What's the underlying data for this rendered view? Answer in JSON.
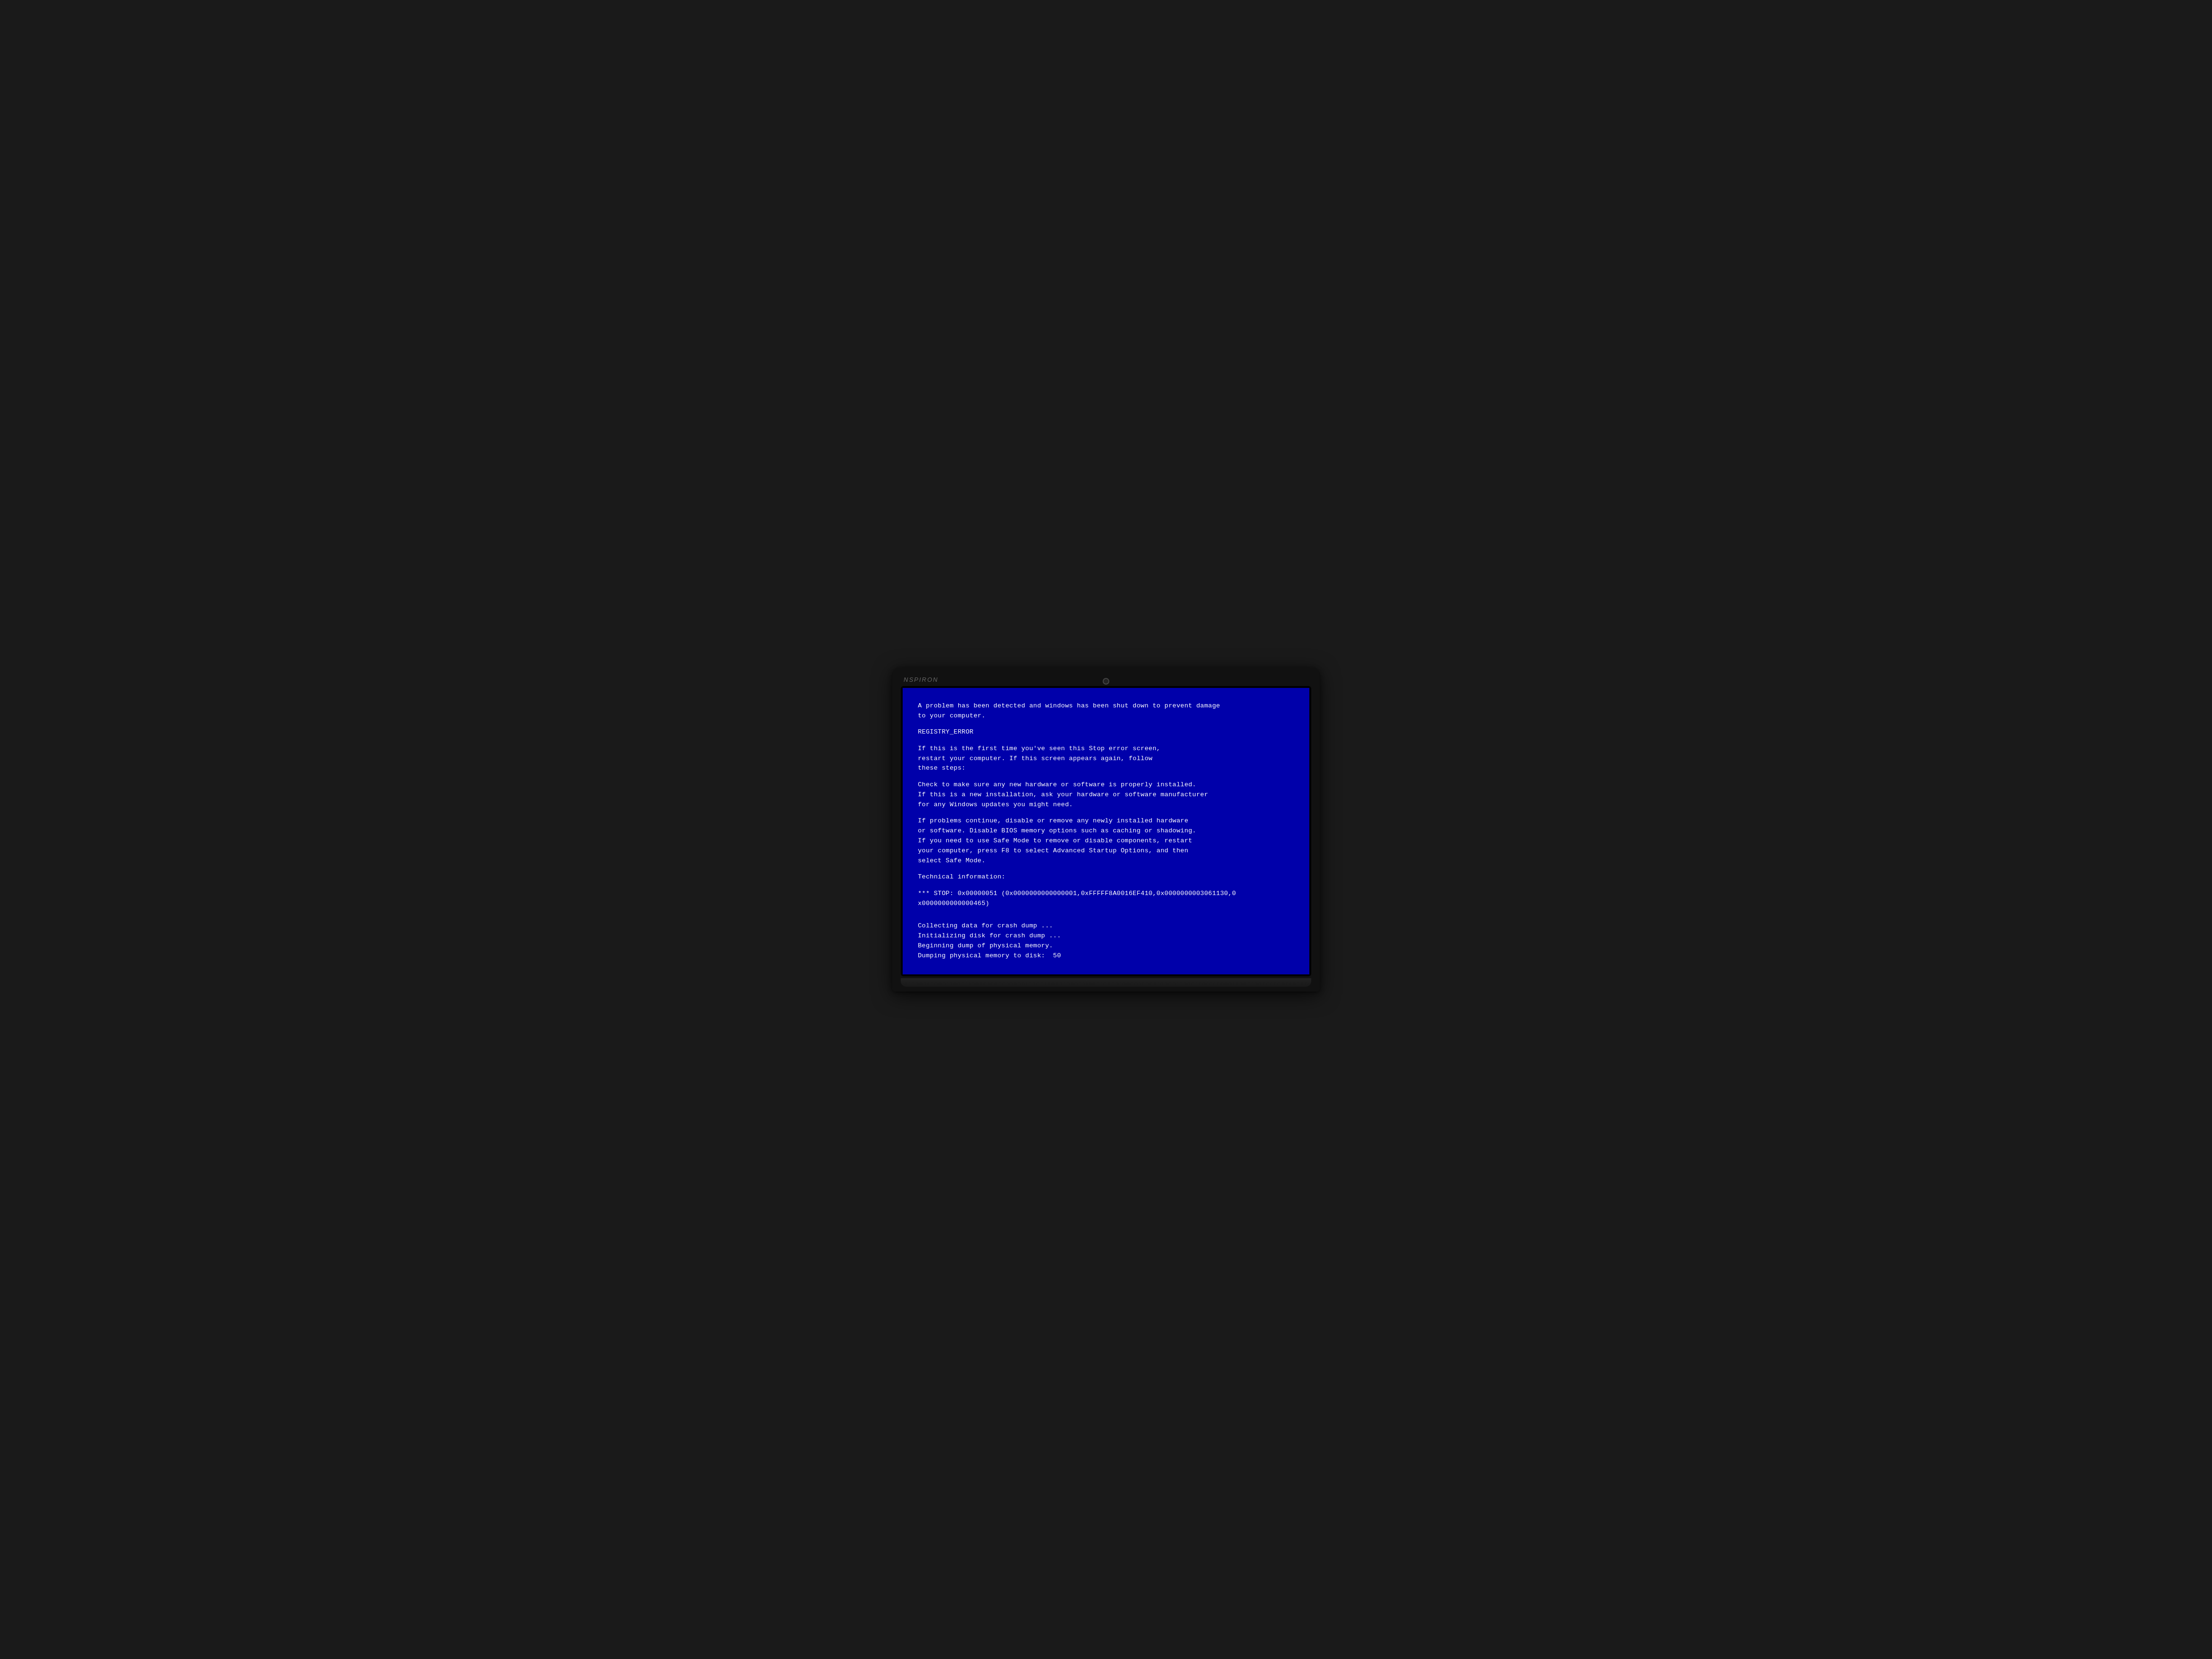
{
  "laptop": {
    "brand": "NSPIRON"
  },
  "bsod": {
    "line1": "A problem has been detected and windows has been shut down to prevent damage",
    "line2": "to your computer.",
    "spacer1": "",
    "error_code": "REGISTRY_ERROR",
    "spacer2": "",
    "line3": "If this is the first time you've seen this Stop error screen,",
    "line4": "restart your computer. If this screen appears again, follow",
    "line5": "these steps:",
    "spacer3": "",
    "line6": "Check to make sure any new hardware or software is properly installed.",
    "line7": "If this is a new installation, ask your hardware or software manufacturer",
    "line8": "for any Windows updates you might need.",
    "spacer4": "",
    "line9": "If problems continue, disable or remove any newly installed hardware",
    "line10": "or software. Disable BIOS memory options such as caching or shadowing.",
    "line11": "If you need to use Safe Mode to remove or disable components, restart",
    "line12": "your computer, press F8 to select Advanced Startup Options, and then",
    "line13": "select Safe Mode.",
    "spacer5": "",
    "line14": "Technical information:",
    "spacer6": "",
    "line15": "*** STOP: 0x00000051 (0x0000000000000001,0xFFFFF8A0016EF410,0x0000000003061130,0",
    "line16": "x0000000000000465)",
    "spacer7": "",
    "spacer8": "",
    "line17": "Collecting data for crash dump ...",
    "line18": "Initializing disk for crash dump ...",
    "line19": "Beginning dump of physical memory.",
    "line20": "Dumping physical memory to disk:  50"
  }
}
